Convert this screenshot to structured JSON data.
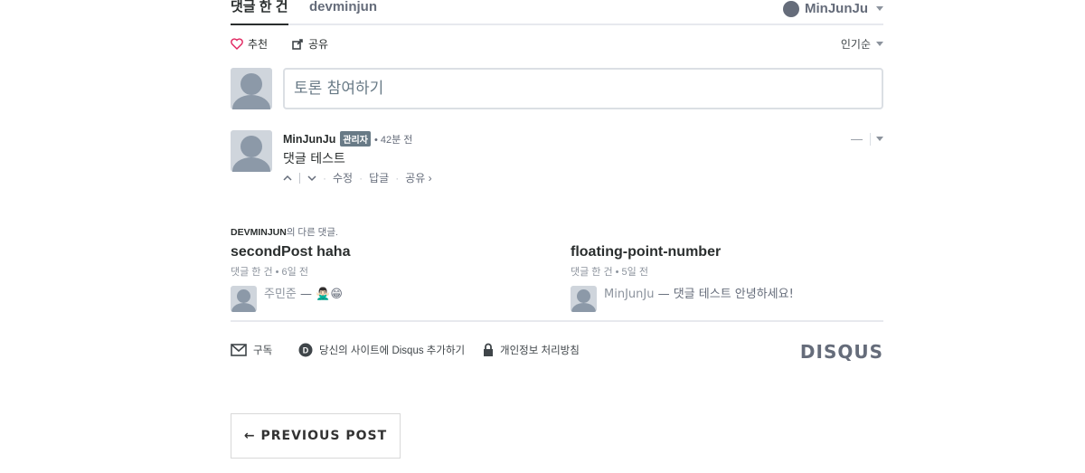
{
  "nav": {
    "tab_comments": "댓글 한 건",
    "tab_forum": "devminjun",
    "user": "MinJunJu"
  },
  "actions": {
    "recommend": "추천",
    "share": "공유",
    "sort": "인기순"
  },
  "composer": {
    "placeholder": "토론 참여하기"
  },
  "comment": {
    "author": "MinJunJu",
    "badge": "관리자",
    "time": "• 42분 전",
    "text": "댓글 테스트",
    "menu": "—",
    "edit": "수정",
    "reply": "답글",
    "share": "공유 ›"
  },
  "more": {
    "forum": "DEVMINJUN",
    "suffix": "의 다른 댓글.",
    "items": [
      {
        "title": "secondPost haha",
        "meta": "댓글 한 건 • 6일 전",
        "name": "주민준",
        "snippet": " — 🙅🏻‍♂️😁"
      },
      {
        "title": "floating-point-number",
        "meta": "댓글 한 건 • 5일 전",
        "name": "MinJunJu",
        "snippet": " — 댓글 테스트 안녕하세요!"
      }
    ]
  },
  "footer": {
    "subscribe": "구독",
    "add_disqus": "당신의 사이트에 Disqus 추가하기",
    "privacy": "개인정보 처리방침",
    "brand": "DISQUS"
  },
  "pager": {
    "prev": "← PREVIOUS POST"
  }
}
